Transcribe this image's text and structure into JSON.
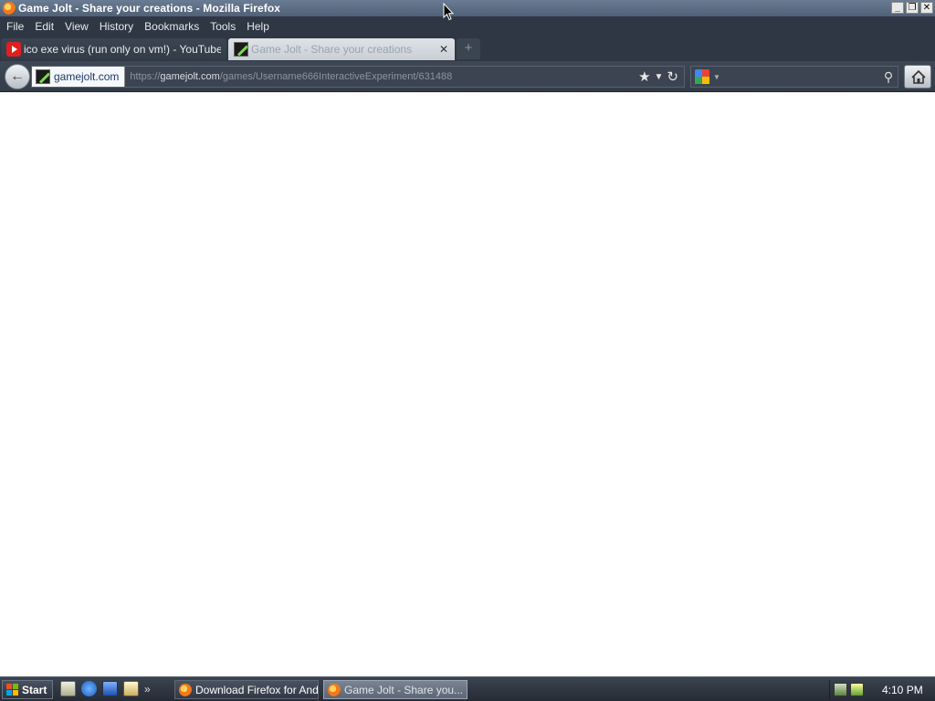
{
  "window": {
    "title": "Game Jolt - Share your creations - Mozilla Firefox",
    "controls": {
      "minimize": "_",
      "maximize": "❐",
      "close": "✕"
    }
  },
  "menubar": {
    "items": [
      {
        "label": "File"
      },
      {
        "label": "Edit"
      },
      {
        "label": "View"
      },
      {
        "label": "History"
      },
      {
        "label": "Bookmarks"
      },
      {
        "label": "Tools"
      },
      {
        "label": "Help"
      }
    ]
  },
  "tabs": [
    {
      "label": "ico exe virus (run only on vm!) - YouTube",
      "icon": "youtube-icon",
      "active": false
    },
    {
      "label": "Game Jolt - Share your creations",
      "icon": "gamejolt-icon",
      "active": true
    }
  ],
  "newtab": {
    "label": "+"
  },
  "navbar": {
    "back_label": "←",
    "identity_label": "gamejolt.com",
    "url_prefix": "https://",
    "url_host": "gamejolt.com",
    "url_path": "/games/Username666InteractiveExperiment/631488",
    "bookmark_star": "★",
    "url_dropdown": "▼",
    "reload": "↻",
    "search_placeholder": "",
    "search_dropdown": "▼",
    "search_magnifier": "⚲"
  },
  "taskbar": {
    "start_label": "Start",
    "quick_more": "»",
    "tasks": [
      {
        "label": "Download Firefox for And...",
        "active": false
      },
      {
        "label": "Game Jolt - Share you...",
        "active": true
      }
    ],
    "clock": "4:10 PM"
  },
  "colors": {
    "titlebar": "#5a6b82",
    "chrome_dark": "#2e3743",
    "content_bg": "#ffffff",
    "taskbar": "#2f3540"
  }
}
